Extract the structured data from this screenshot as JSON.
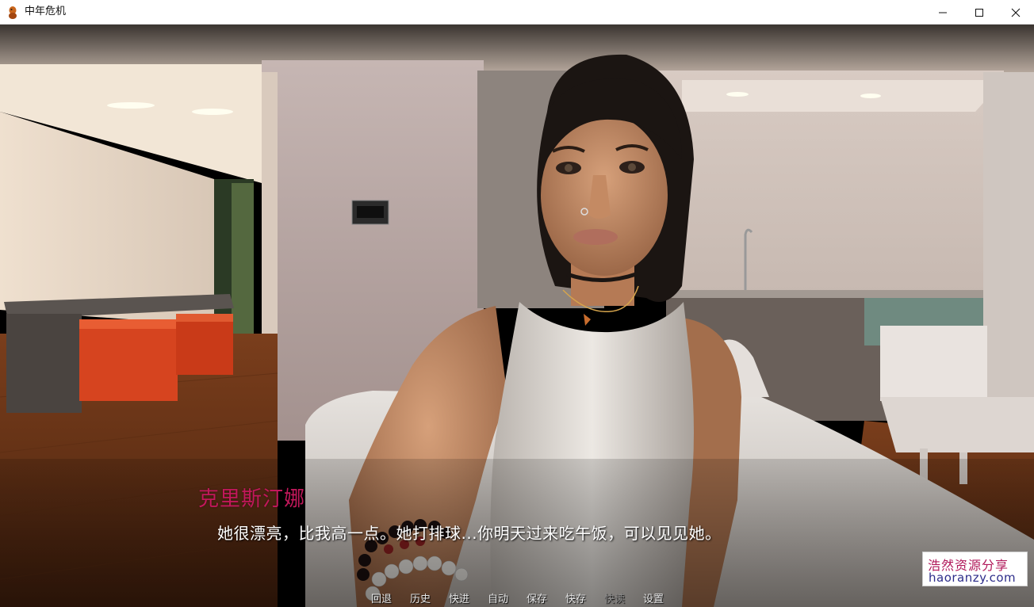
{
  "window": {
    "title": "中年危机",
    "minimize_glyph": "—",
    "maximize_glyph": "☐",
    "close_glyph": "✕"
  },
  "dialogue": {
    "speaker": "克里斯汀娜",
    "speaker_color": "#c2185b",
    "text": "她很漂亮，比我高一点。她打排球...你明天过来吃午饭，可以见见她。"
  },
  "quick_menu": {
    "items": [
      {
        "label": "回退",
        "enabled": true
      },
      {
        "label": "历史",
        "enabled": true
      },
      {
        "label": "快进",
        "enabled": true
      },
      {
        "label": "自动",
        "enabled": true
      },
      {
        "label": "保存",
        "enabled": true
      },
      {
        "label": "快存",
        "enabled": true
      },
      {
        "label": "快读",
        "enabled": false
      },
      {
        "label": "设置",
        "enabled": true
      }
    ]
  },
  "watermark": {
    "name": "浩然资源分享",
    "url": "haoranzy.com"
  },
  "scene": {
    "description_icon": "character-portrait"
  }
}
